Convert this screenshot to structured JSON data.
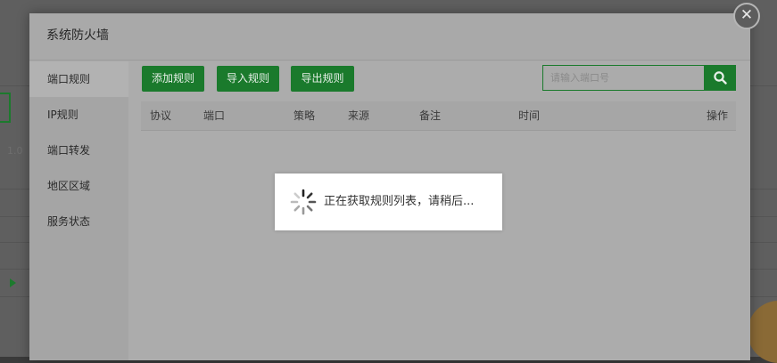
{
  "background": {
    "partial_text": "1.0"
  },
  "modal": {
    "title": "系统防火墙",
    "close_icon": "close-icon",
    "sidebar": {
      "items": [
        {
          "label": "端口规则",
          "active": true
        },
        {
          "label": "IP规则",
          "active": false
        },
        {
          "label": "端口转发",
          "active": false
        },
        {
          "label": "地区区域",
          "active": false
        },
        {
          "label": "服务状态",
          "active": false
        }
      ]
    },
    "toolbar": {
      "add_label": "添加规则",
      "import_label": "导入规则",
      "export_label": "导出规则",
      "search_placeholder": "请输入端口号",
      "search_icon": "search-icon"
    },
    "table": {
      "columns": [
        "协议",
        "端口",
        "策略",
        "来源",
        "备注",
        "时间",
        "操作"
      ]
    },
    "loading": {
      "text": "正在获取规则列表，请稍后..."
    }
  },
  "colors": {
    "accent": "#1a7a2c",
    "overlay": "#a9a9a9"
  }
}
